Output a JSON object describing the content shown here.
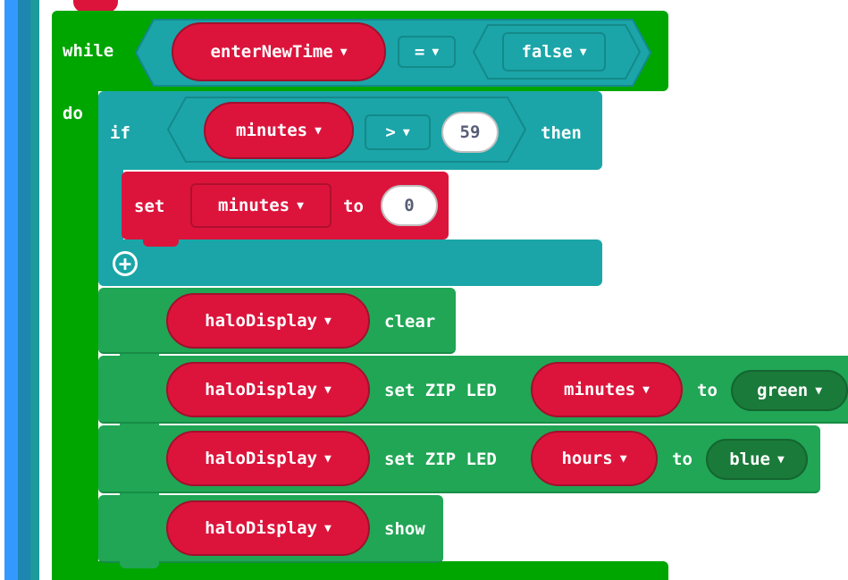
{
  "colors": {
    "loop_green": "#00a600",
    "logic_teal": "#1ba5a8",
    "variable_red": "#dc143c",
    "neopixel_green": "#20a655",
    "dark_green_pill": "#1a7a3a",
    "side_blue": "#3399ff"
  },
  "while_block": {
    "keyword": "while",
    "do_label": "do",
    "condition": {
      "left_var": "enterNewTime",
      "operator": "=",
      "right_value": "false"
    }
  },
  "if_block": {
    "keyword": "if",
    "then_label": "then",
    "condition": {
      "left_var": "minutes",
      "operator": ">",
      "right_value": "59"
    },
    "body": {
      "set_keyword": "set",
      "variable": "minutes",
      "to_label": "to",
      "value": "0"
    },
    "add_icon": "plus-circle-icon"
  },
  "statements": [
    {
      "target": "haloDisplay",
      "action": "clear"
    },
    {
      "target": "haloDisplay",
      "action": "set ZIP LED",
      "arg_var": "minutes",
      "to_label": "to",
      "color": "green"
    },
    {
      "target": "haloDisplay",
      "action": "set ZIP LED",
      "arg_var": "hours",
      "to_label": "to",
      "color": "blue"
    },
    {
      "target": "haloDisplay",
      "action": "show"
    }
  ],
  "dropdown_icon": "caret-down-icon"
}
